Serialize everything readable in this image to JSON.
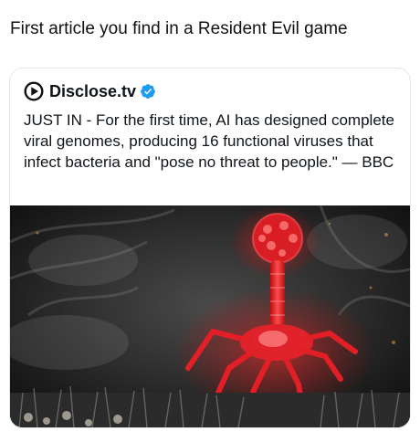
{
  "caption": "First article you find in a Resident Evil game",
  "post": {
    "author_name": "Disclose.tv",
    "avatar_icon": "disclose-play-logo-icon",
    "verified_icon": "verified-badge-icon",
    "verified_color": "#1d9bf0",
    "text": "JUST IN - For the first time, AI has designed complete viral genomes, producing 16 functional viruses that infect bacteria and \"pose no threat to people.\" — BBC",
    "media_description_icon": "red-bacteriophage-image"
  },
  "colors": {
    "accent_red": "#e8232a",
    "text": "#0f1419",
    "border": "#e3e6e8"
  }
}
